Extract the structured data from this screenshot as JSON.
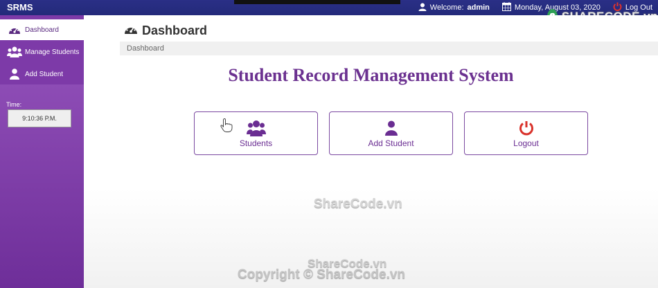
{
  "app": {
    "brand": "SRMS"
  },
  "topbar": {
    "welcome_prefix": "Welcome:",
    "username": "admin",
    "date": "Monday, August 03, 2020",
    "logout_label": "Log Out"
  },
  "sidebar": {
    "items": [
      {
        "label": "Dashboard",
        "icon": "dashboard-icon"
      },
      {
        "label": "Manage Students",
        "icon": "users-icon"
      },
      {
        "label": "Add Student",
        "icon": "user-icon"
      }
    ],
    "time_label": "Time:",
    "time_value": "9:10:36 P.M."
  },
  "main": {
    "page_title": "Dashboard",
    "breadcrumb": "Dashboard",
    "system_title": "Student Record Management System",
    "cards": [
      {
        "label": "Students",
        "icon": "users-icon"
      },
      {
        "label": "Add Student",
        "icon": "user-icon"
      },
      {
        "label": "Logout",
        "icon": "power-icon"
      }
    ]
  },
  "watermarks": {
    "logo_text": "SHARECODE.vn",
    "center": "ShareCode.vn",
    "bottom_small": "ShareCode.vn",
    "copyright": "Copyright © ShareCode.vn"
  },
  "colors": {
    "topbar": "#2a2f86",
    "sidebar": "#7d3aa8",
    "accent_purple": "#6b3190",
    "logout_red": "#d9322b"
  }
}
